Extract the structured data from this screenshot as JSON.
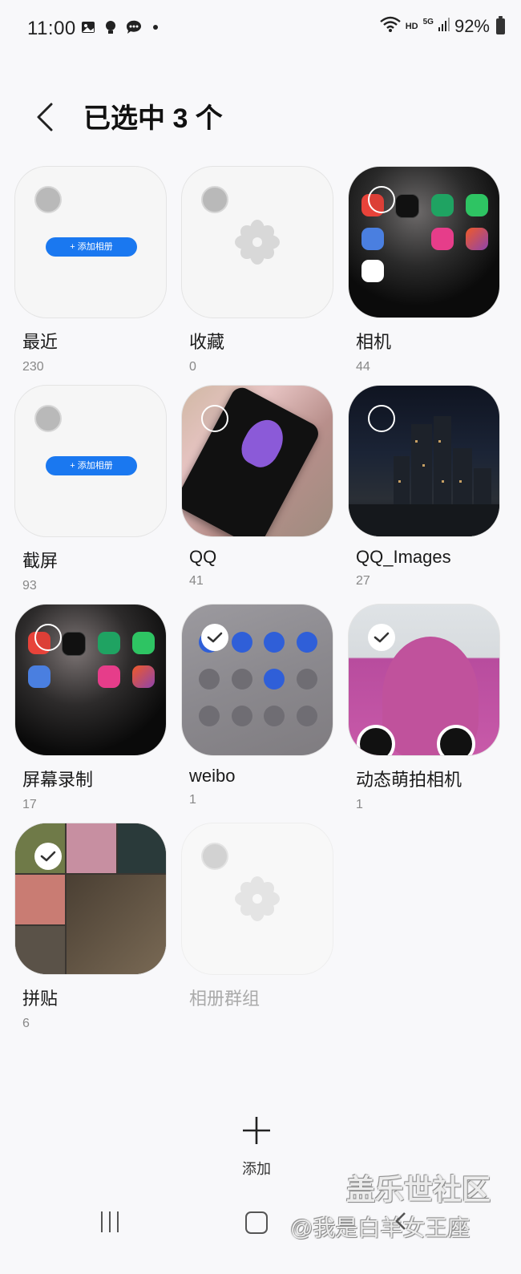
{
  "status_bar": {
    "time": "11:00",
    "hd": "HD",
    "network": "5G",
    "battery": "92%"
  },
  "header": {
    "title": "已选中 3 个"
  },
  "add_album_label": "添加相册",
  "albums": [
    {
      "name": "最近",
      "count": "230",
      "state": "unselected-disabled"
    },
    {
      "name": "收藏",
      "count": "0",
      "state": "unselected-disabled"
    },
    {
      "name": "相机",
      "count": "44",
      "state": "unselected"
    },
    {
      "name": "截屏",
      "count": "93",
      "state": "unselected-disabled"
    },
    {
      "name": "QQ",
      "count": "41",
      "state": "unselected"
    },
    {
      "name": "QQ_Images",
      "count": "27",
      "state": "unselected"
    },
    {
      "name": "屏幕录制",
      "count": "17",
      "state": "unselected"
    },
    {
      "name": "weibo",
      "count": "1",
      "state": "selected"
    },
    {
      "name": "动态萌拍相机",
      "count": "1",
      "state": "selected"
    },
    {
      "name": "拼贴",
      "count": "6",
      "state": "selected"
    },
    {
      "name": "相册群组",
      "count": "",
      "state": "disabled"
    }
  ],
  "bottom_action": {
    "icon": "plus-icon",
    "label": "添加"
  },
  "watermark": {
    "line1": "盖乐世社区",
    "line2": "@我是白羊女王座"
  },
  "colors": {
    "accent": "#1a78f0",
    "background": "#f8f8fa"
  }
}
